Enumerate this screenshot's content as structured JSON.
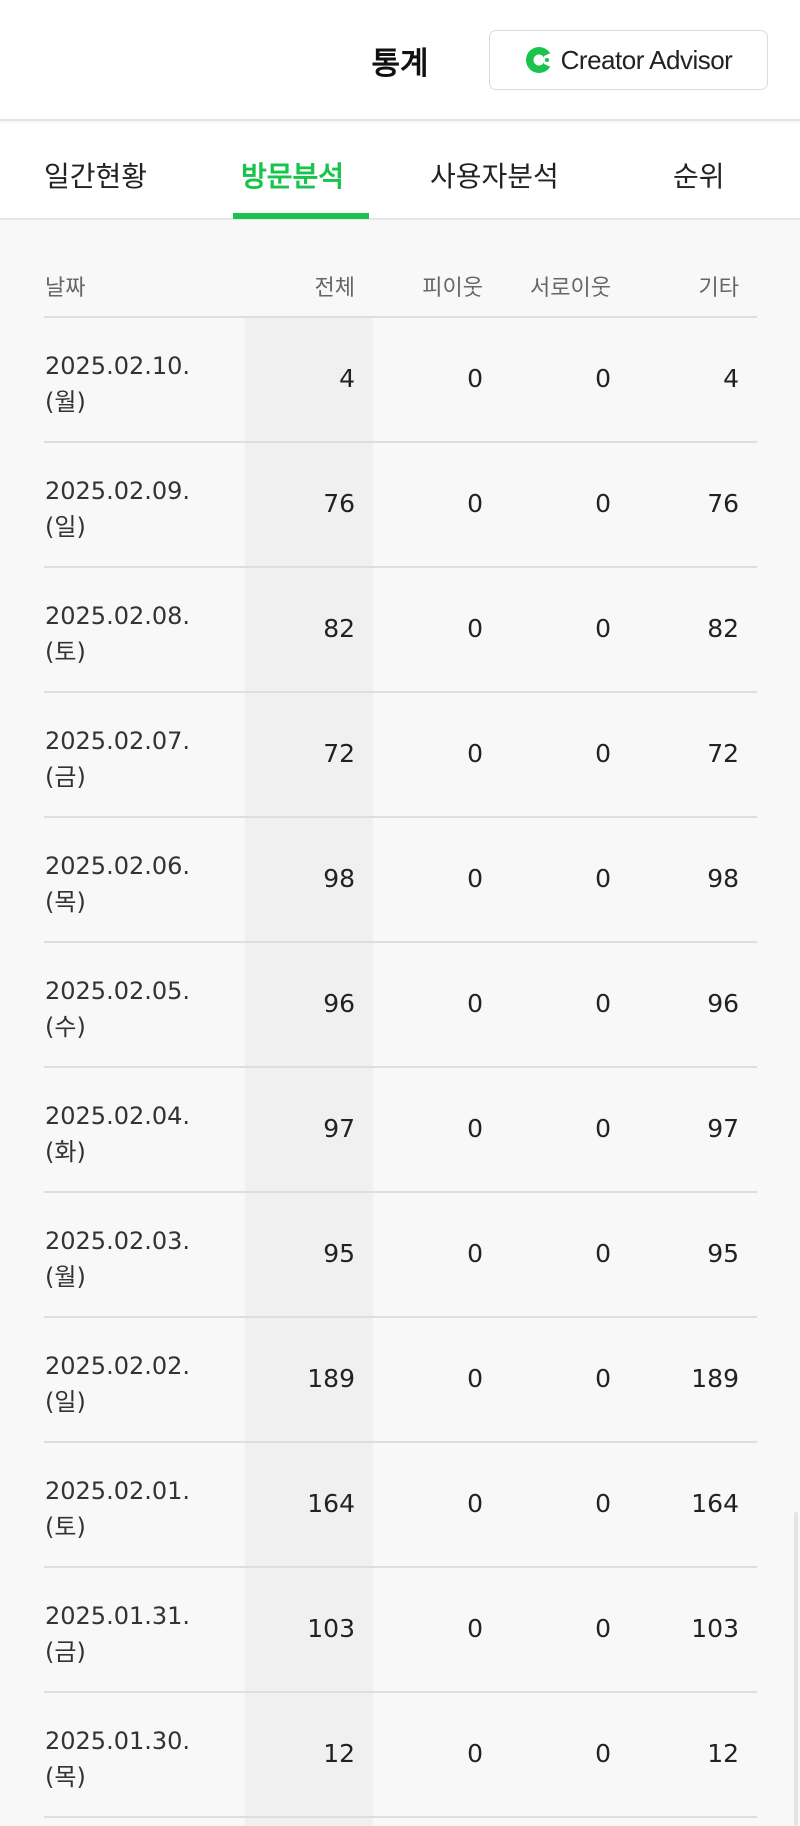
{
  "header": {
    "title": "통계",
    "creator_advisor_label": "Creator Advisor",
    "brand_color": "#19c34c"
  },
  "tabs": [
    {
      "label": "일간현황"
    },
    {
      "label": "방문분석",
      "active": true
    },
    {
      "label": "사용자분석"
    },
    {
      "label": "순위"
    }
  ],
  "table": {
    "columns": [
      "날짜",
      "전체",
      "피이웃",
      "서로이웃",
      "기타"
    ],
    "rows": [
      {
        "date": "2025.02.10.",
        "day": "(월)",
        "total": "4",
        "neighbor": "0",
        "mutual": "0",
        "other": "4"
      },
      {
        "date": "2025.02.09.",
        "day": "(일)",
        "total": "76",
        "neighbor": "0",
        "mutual": "0",
        "other": "76"
      },
      {
        "date": "2025.02.08.",
        "day": "(토)",
        "total": "82",
        "neighbor": "0",
        "mutual": "0",
        "other": "82"
      },
      {
        "date": "2025.02.07.",
        "day": "(금)",
        "total": "72",
        "neighbor": "0",
        "mutual": "0",
        "other": "72"
      },
      {
        "date": "2025.02.06.",
        "day": "(목)",
        "total": "98",
        "neighbor": "0",
        "mutual": "0",
        "other": "98"
      },
      {
        "date": "2025.02.05.",
        "day": "(수)",
        "total": "96",
        "neighbor": "0",
        "mutual": "0",
        "other": "96"
      },
      {
        "date": "2025.02.04.",
        "day": "(화)",
        "total": "97",
        "neighbor": "0",
        "mutual": "0",
        "other": "97"
      },
      {
        "date": "2025.02.03.",
        "day": "(월)",
        "total": "95",
        "neighbor": "0",
        "mutual": "0",
        "other": "95"
      },
      {
        "date": "2025.02.02.",
        "day": "(일)",
        "total": "189",
        "neighbor": "0",
        "mutual": "0",
        "other": "189"
      },
      {
        "date": "2025.02.01.",
        "day": "(토)",
        "total": "164",
        "neighbor": "0",
        "mutual": "0",
        "other": "164"
      },
      {
        "date": "2025.01.31.",
        "day": "(금)",
        "total": "103",
        "neighbor": "0",
        "mutual": "0",
        "other": "103"
      },
      {
        "date": "2025.01.30.",
        "day": "(목)",
        "total": "12",
        "neighbor": "0",
        "mutual": "0",
        "other": "12"
      }
    ]
  }
}
